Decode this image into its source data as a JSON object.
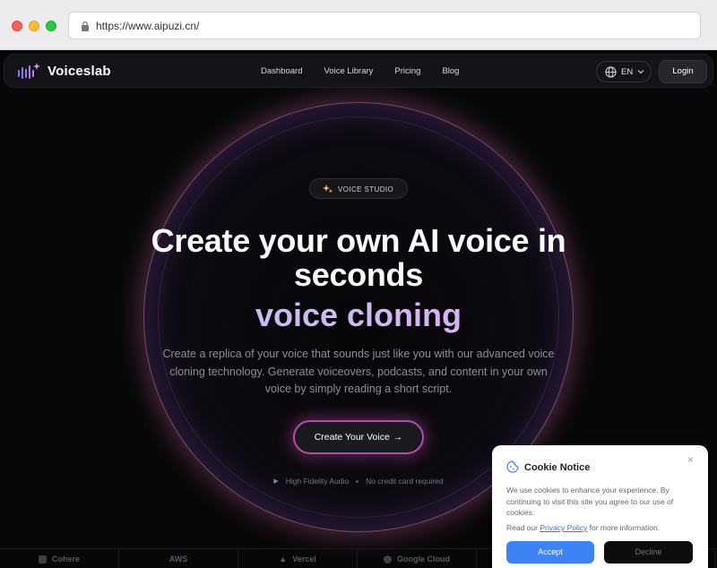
{
  "browser": {
    "url": "https://www.aipuzi.cn/"
  },
  "navbar": {
    "brand": "Voiceslab",
    "links": [
      "Dashboard",
      "Voice Library",
      "Pricing",
      "Blog"
    ],
    "language": "EN",
    "login_label": "Login"
  },
  "hero": {
    "badge": "VOICE STUDIO",
    "headline_line1": "Create your own AI voice in",
    "headline_line2": "seconds",
    "highlight": "voice cloning",
    "subtext": "Create a replica of your voice that sounds just like you with our advanced voice cloning technology. Generate voiceovers, podcasts, and content in your own voice by simply reading a short script.",
    "cta_label": "Create Your Voice",
    "features": [
      "High Fidelity Audio",
      "No credit card required"
    ]
  },
  "partners": [
    "Cohere",
    "AWS",
    "Vercel",
    "Google Cloud",
    "",
    ""
  ],
  "cookie": {
    "title": "Cookie Notice",
    "body": "We use cookies to enhance your experience. By continuing to visit this site you agree to our use of cookies.",
    "privacy_prefix": "Read our",
    "privacy_link": "Privacy Policy",
    "privacy_suffix": "for more information.",
    "accept_label": "Accept",
    "decline_label": "Decline"
  },
  "colors": {
    "accent_blue": "#3c83f6",
    "cta_border": "#b04ea7",
    "glow": "#c460a0",
    "background": "#070709"
  },
  "icons": {
    "logo": "waveform-sparkle-icon",
    "language": "globe-icon",
    "badge": "sparkle-icon",
    "cookie": "cookie-icon",
    "close": "close-icon"
  }
}
